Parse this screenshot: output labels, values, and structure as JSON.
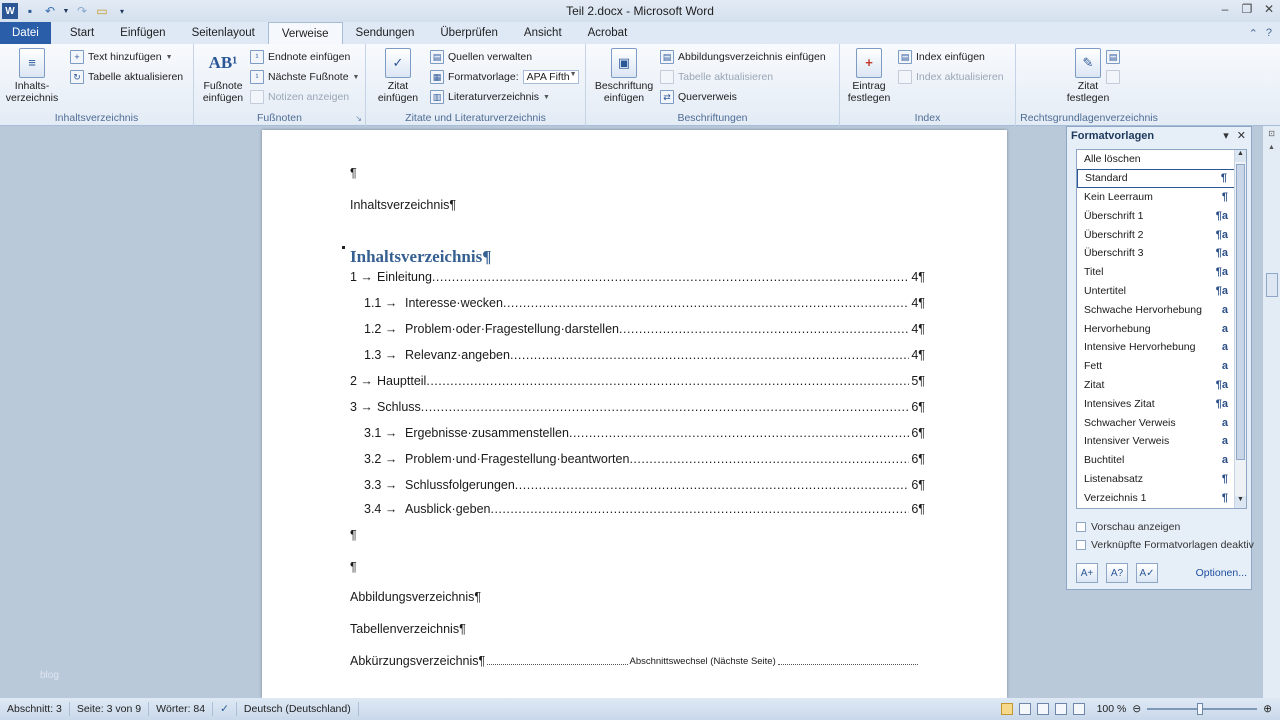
{
  "window": {
    "title": "Teil 2.docx - Microsoft Word",
    "qat": [
      "word-icon",
      "save-icon",
      "undo-icon",
      "redo-icon",
      "open-icon",
      "customize-icon"
    ]
  },
  "tabs": [
    "Datei",
    "Start",
    "Einfügen",
    "Seitenlayout",
    "Verweise",
    "Sendungen",
    "Überprüfen",
    "Ansicht",
    "Acrobat"
  ],
  "ribbon": {
    "toc": {
      "big": "Inhalts-\nverzeichnis",
      "add_text": "Text hinzufügen",
      "update": "Tabelle aktualisieren",
      "group": "Inhaltsverzeichnis"
    },
    "footnotes": {
      "insert": "Fußnote\neinfügen",
      "endnote": "Endnote einfügen",
      "next": "Nächste Fußnote",
      "show": "Notizen anzeigen",
      "group": "Fußnoten"
    },
    "citations": {
      "insert": "Zitat\neinfügen",
      "manage": "Quellen verwalten",
      "style_label": "Formatvorlage:",
      "style_value": "APA Fifth",
      "bibliography": "Literaturverzeichnis",
      "group": "Zitate und Literaturverzeichnis"
    },
    "captions": {
      "insert": "Beschriftung\neinfügen",
      "figures": "Abbildungsverzeichnis einfügen",
      "update": "Tabelle aktualisieren",
      "cross": "Querverweis",
      "group": "Beschriftungen"
    },
    "index": {
      "mark": "Eintrag\nfestlegen",
      "insert": "Index einfügen",
      "update": "Index aktualisieren",
      "group": "Index"
    },
    "authorities": {
      "mark": "Zitat\nfestlegen",
      "group": "Rechtsgrundlagenverzeichnis"
    }
  },
  "document": {
    "pilcrow": "¶",
    "line1": "Inhaltsverzeichnis¶",
    "heading": "Inhaltsverzeichnis¶",
    "toc": [
      {
        "num": "1 →",
        "text": "Einleitung",
        "page": "4¶"
      },
      {
        "num": "1.1 →",
        "text": "Interesse·wecken",
        "page": "4¶"
      },
      {
        "num": "1.2 →",
        "text": "Problem·oder·Fragestellung·darstellen",
        "page": "4¶"
      },
      {
        "num": "1.3 →",
        "text": "Relevanz·angeben",
        "page": "4¶"
      },
      {
        "num": "2 →",
        "text": "Hauptteil",
        "page": "5¶"
      },
      {
        "num": "3 →",
        "text": "Schluss",
        "page": "6¶"
      },
      {
        "num": "3.1 →",
        "text": "Ergebnisse·zusammenstellen",
        "page": "6¶"
      },
      {
        "num": "3.2 →",
        "text": "Problem·und·Fragestellung·beantworten",
        "page": "6¶"
      },
      {
        "num": "3.3 →",
        "text": "Schlussfolgerungen",
        "page": "6¶"
      },
      {
        "num": "3.4 →",
        "text": "Ausblick·geben",
        "page": "6¶"
      }
    ],
    "figures": "Abbildungsverzeichnis¶",
    "tables": "Tabellenverzeichnis¶",
    "abbrev": "Abkürzungsverzeichnis¶",
    "section_break": "Abschnittswechsel (Nächste Seite)",
    "watermark": "blog"
  },
  "styles_pane": {
    "title": "Formatvorlagen",
    "items": [
      {
        "name": "Alle löschen",
        "icon": ""
      },
      {
        "name": "Standard",
        "icon": "¶"
      },
      {
        "name": "Kein Leerraum",
        "icon": "¶"
      },
      {
        "name": "Überschrift 1",
        "icon": "¶a"
      },
      {
        "name": "Überschrift 2",
        "icon": "¶a"
      },
      {
        "name": "Überschrift 3",
        "icon": "¶a"
      },
      {
        "name": "Titel",
        "icon": "¶a"
      },
      {
        "name": "Untertitel",
        "icon": "¶a"
      },
      {
        "name": "Schwache Hervorhebung",
        "icon": "a"
      },
      {
        "name": "Hervorhebung",
        "icon": "a"
      },
      {
        "name": "Intensive Hervorhebung",
        "icon": "a"
      },
      {
        "name": "Fett",
        "icon": "a"
      },
      {
        "name": "Zitat",
        "icon": "¶a"
      },
      {
        "name": "Intensives Zitat",
        "icon": "¶a"
      },
      {
        "name": "Schwacher Verweis",
        "icon": "a"
      },
      {
        "name": "Intensiver Verweis",
        "icon": "a"
      },
      {
        "name": "Buchtitel",
        "icon": "a"
      },
      {
        "name": "Listenabsatz",
        "icon": "¶"
      },
      {
        "name": "Verzeichnis 1",
        "icon": "¶"
      }
    ],
    "selected": "Standard",
    "preview": "Vorschau anzeigen",
    "linked": "Verknüpfte Formatvorlagen deaktiv",
    "options": "Optionen..."
  },
  "status": {
    "section": "Abschnitt: 3",
    "page": "Seite: 3 von 9",
    "words": "Wörter: 84",
    "language": "Deutsch (Deutschland)",
    "zoom": "100 %"
  },
  "colors": {
    "file_tab": "#2a5ea8",
    "heading": "#366092",
    "selection_border": "#2b5797"
  }
}
